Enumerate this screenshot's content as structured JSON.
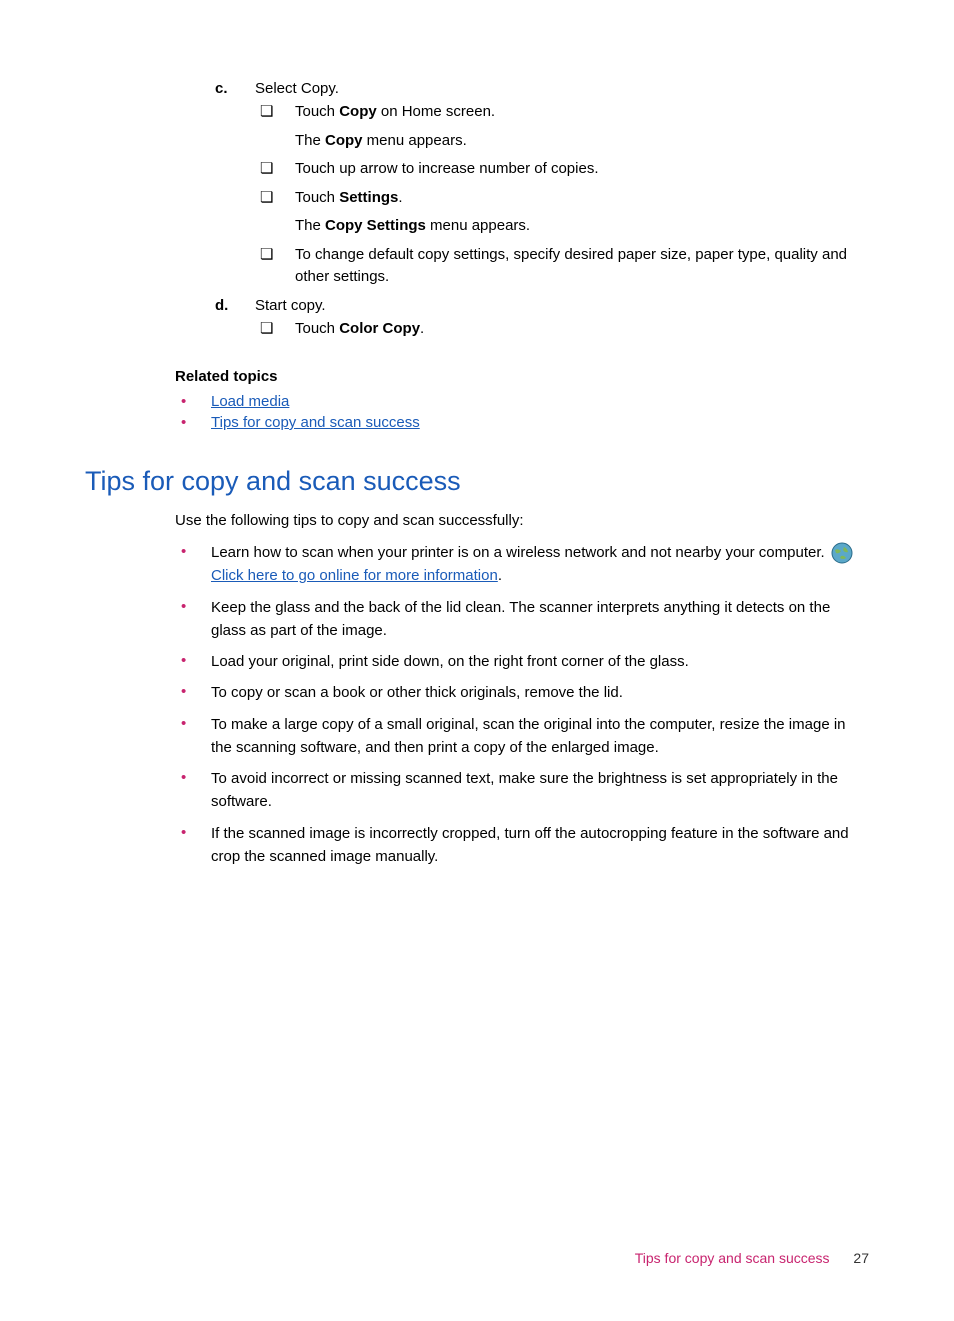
{
  "steps": {
    "c": {
      "letter": "c",
      "text": "Select Copy.",
      "items": [
        {
          "html": "Touch <b>Copy</b> on Home screen."
        },
        {
          "sub": "The <b>Copy</b> menu appears."
        },
        {
          "html": "Touch up arrow to increase number of copies."
        },
        {
          "html": "Touch <b>Settings</b>."
        },
        {
          "sub": "The <b>Copy Settings</b> menu appears."
        },
        {
          "html": "To change default copy settings, specify desired paper size, paper type, quality and other settings."
        }
      ]
    },
    "d": {
      "letter": "d",
      "text": "Start copy.",
      "items": [
        {
          "html": "Touch <b>Color Copy</b>."
        }
      ]
    }
  },
  "related": {
    "heading": "Related topics",
    "links": [
      "Load media",
      "Tips for copy and scan success"
    ]
  },
  "section": {
    "title": "Tips for copy and scan success",
    "intro": "Use the following tips to copy and scan successfully:",
    "tips": [
      {
        "pre": "Learn how to scan when your printer is on a wireless network and not nearby your computer. ",
        "link": " Click here to go online for more information",
        "post": ".",
        "hasIcon": true
      },
      {
        "text": "Keep the glass and the back of the lid clean. The scanner interprets anything it detects on the glass as part of the image."
      },
      {
        "text": "Load your original, print side down, on the right front corner of the glass."
      },
      {
        "text": "To copy or scan a book or other thick originals, remove the lid."
      },
      {
        "text": "To make a large copy of a small original, scan the original into the computer, resize the image in the scanning software, and then print a copy of the enlarged image."
      },
      {
        "text": "To avoid incorrect or missing scanned text, make sure the brightness is set appropriately in the software."
      },
      {
        "text": "If the scanned image is incorrectly cropped, turn off the autocropping feature in the software and crop the scanned image manually."
      }
    ]
  },
  "footer": {
    "title": "Tips for copy and scan success",
    "page": "27"
  }
}
